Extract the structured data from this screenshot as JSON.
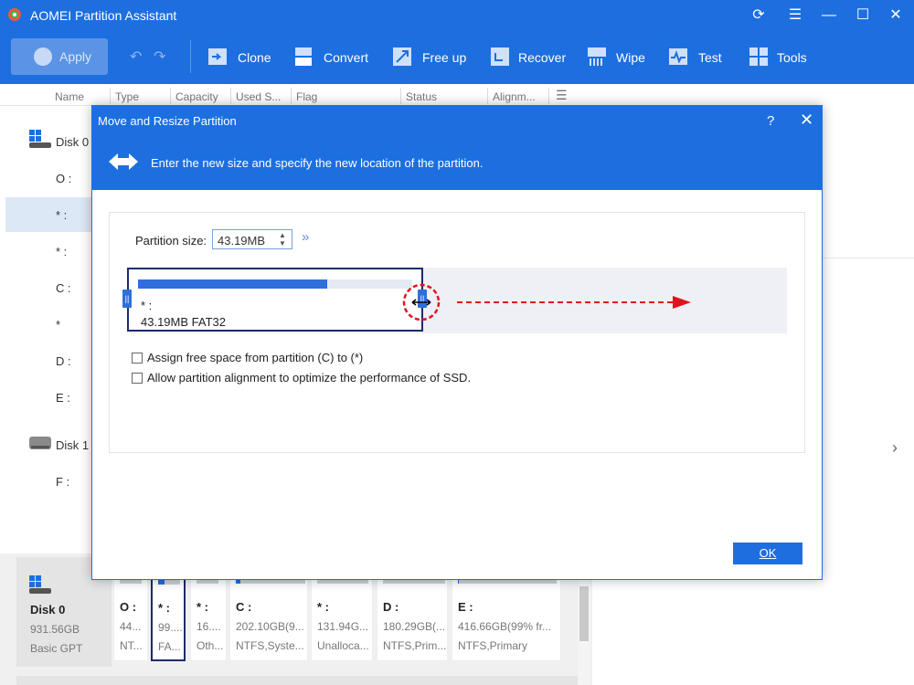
{
  "app": {
    "title": "AOMEI Partition Assistant"
  },
  "toolbar": {
    "apply_label": "Apply",
    "tools": [
      {
        "label": "Clone",
        "icon": "clone-icon"
      },
      {
        "label": "Convert",
        "icon": "convert-icon"
      },
      {
        "label": "Free up",
        "icon": "free-up-icon"
      },
      {
        "label": "Recover",
        "icon": "recover-icon"
      },
      {
        "label": "Wipe",
        "icon": "wipe-icon"
      },
      {
        "label": "Test",
        "icon": "test-icon"
      },
      {
        "label": "Tools",
        "icon": "tools-icon"
      }
    ]
  },
  "columns": [
    "Name",
    "Type",
    "Capacity",
    "Used S...",
    "Flag",
    "Status",
    "Alignm..."
  ],
  "list": {
    "disk0": "Disk 0",
    "rows0": [
      "O :",
      "* :",
      "* :",
      "C :",
      "*",
      "D :",
      "E :"
    ],
    "disk1": "Disk 1",
    "rows1": [
      "F :"
    ]
  },
  "dialog": {
    "title": "Move and Resize Partition",
    "help": "?",
    "subtitle": "Enter the new size and specify the new location of the partition.",
    "size_label": "Partition size:",
    "size_value": "43.19MB",
    "expand": "»",
    "partition_name": "* :",
    "partition_desc": "43.19MB FAT32",
    "partition_fill": 0.69,
    "opt1": "Assign free space from partition (C) to (*)",
    "opt2": "Allow partition alignment to optimize the performance of SSD.",
    "ok_label": "OK"
  },
  "disk_card": {
    "name": "Disk 0",
    "size": "931.56GB",
    "type": "Basic GPT"
  },
  "partitions": [
    {
      "name": "O :",
      "size": "44...",
      "fs": "NT..."
    },
    {
      "name": "* :",
      "size": "99....",
      "fs": "FA..."
    },
    {
      "name": "* :",
      "size": "16....",
      "fs": "Oth..."
    },
    {
      "name": "C :",
      "size": "202.10GB(9...",
      "fs": "NTFS,Syste..."
    },
    {
      "name": "* :",
      "size": "131.94G...",
      "fs": "Unalloca..."
    },
    {
      "name": "D :",
      "size": "180.29GB(...",
      "fs": "NTFS,Prim..."
    },
    {
      "name": "E :",
      "size": "416.66GB(99% fr...",
      "fs": "NTFS,Primary"
    }
  ],
  "colors": {
    "accent": "#1d6fe0",
    "selected_border": "#1c2c6d",
    "annotation": "#e0141e"
  }
}
